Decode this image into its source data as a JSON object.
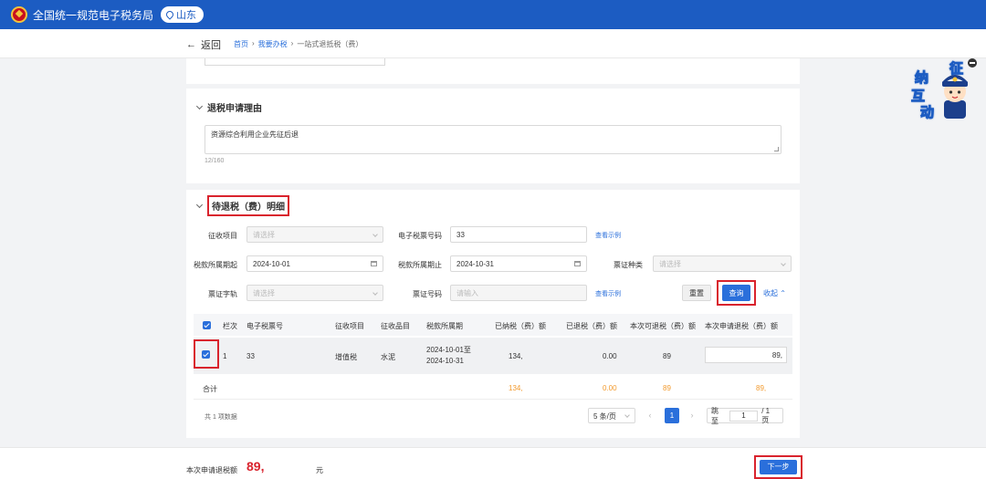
{
  "header": {
    "site_title": "全国统一规范电子税务局",
    "region": "山东",
    "accent_color": "#1c5cc2"
  },
  "nav": {
    "back_label": "返回",
    "breadcrumbs": [
      "首页",
      "我要办税",
      "一站式退抵税（费）"
    ],
    "separator": "›"
  },
  "reason_section": {
    "title": "退税申请理由",
    "text": "资源综合利用企业先征后退",
    "counter": "12/160"
  },
  "detail_section": {
    "title": "待退税（费）明细",
    "filters": {
      "levy_item": {
        "label": "征收项目",
        "placeholder": "请选择"
      },
      "tax_ticket_no": {
        "label": "电子税票号码",
        "value": "33"
      },
      "view_example_1": "查看示例",
      "period_start": {
        "label": "税款所属期起",
        "value": "2024-10-01"
      },
      "period_end": {
        "label": "税款所属期止",
        "value": "2024-10-31"
      },
      "ticket_type": {
        "label": "票证种类",
        "placeholder": "请选择"
      },
      "ticket_word": {
        "label": "票证字轨",
        "placeholder": "请选择"
      },
      "ticket_no": {
        "label": "票证号码",
        "placeholder": "请输入"
      },
      "view_example_2": "查看示例"
    },
    "buttons": {
      "reset": "重置",
      "query": "查询",
      "collapse": "收起"
    },
    "table": {
      "columns": [
        "栏次",
        "电子税票号",
        "征收项目",
        "征收品目",
        "税款所属期",
        "已纳税（费）额",
        "已退税（费）额",
        "本次可退税（费）额",
        "本次申请退税（费）额"
      ],
      "rows": [
        {
          "index": "1",
          "ticket_no": "33",
          "levy_item": "增值税",
          "levy_subitem": "水泥",
          "period_line1": "2024-10-01至",
          "period_line2": "2024-10-31",
          "paid": "134,",
          "refunded": "0.00",
          "refundable": "89",
          "apply": "89,"
        }
      ],
      "summary": {
        "label": "合计",
        "paid": "134,",
        "refunded": "0.00",
        "refundable": "89",
        "apply": "89,"
      }
    },
    "pagination": {
      "total": "共 1 项数据",
      "page_size": "5 条/页",
      "current_page": "1",
      "jump_label": "跳至",
      "jump_value": "1",
      "total_pages": "/ 1 页"
    }
  },
  "footer": {
    "label": "本次申请退税额",
    "amount": "89,",
    "unit": "元",
    "next": "下一步"
  },
  "mascot": {
    "chars": [
      "征",
      "纳",
      "互",
      "动"
    ]
  },
  "colors": {
    "primary": "#2a6fdb",
    "highlight": "#d9232d",
    "summary": "#f29a2e"
  }
}
